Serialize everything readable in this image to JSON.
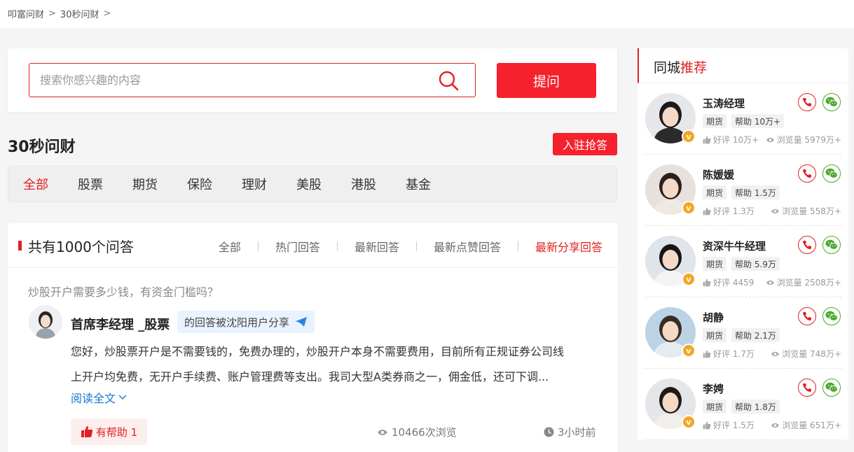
{
  "breadcrumb": [
    "叩富问财",
    "30秒问财"
  ],
  "breadcrumb_sep": ">",
  "search": {
    "placeholder": "搜索你感兴趣的内容",
    "button": "提问"
  },
  "section": {
    "title": "30秒问财",
    "join_button": "入驻抢答"
  },
  "categories": [
    "全部",
    "股票",
    "期货",
    "保险",
    "理财",
    "美股",
    "港股",
    "基金"
  ],
  "active_category": "全部",
  "qa": {
    "count_label": "共有1000个问答",
    "filters": [
      "全部",
      "热门回答",
      "最新回答",
      "最新点赞回答",
      "最新分享回答"
    ],
    "active_filter": "最新分享回答",
    "item": {
      "question": "炒股开户需要多少钱，有资金门槛吗？",
      "answerer": "首席李经理 _股票",
      "share_badge": "的回答被沈阳用户分享",
      "answer_line1": "您好，炒股票开户是不需要钱的，免费办理的，炒股开户本身不需要费用，目前所有正规证券公司线",
      "answer_line2": "上开户均免费，无开户手续费、账户管理费等支出。我司大型A类券商之一，佣金低，还可下调...",
      "read_more": "阅读全文",
      "helpful": "有帮助 1",
      "views": "10466次浏览",
      "time": "3小时前"
    }
  },
  "sidebar": {
    "title_plain": "同城",
    "title_red": "推荐",
    "experts": [
      {
        "name": "玉涛经理",
        "tag": "期货",
        "help": "帮助 10万+",
        "rating": "好评 10万+",
        "views": "浏览量 5979万+"
      },
      {
        "name": "陈媛媛",
        "tag": "期货",
        "help": "帮助 1.5万",
        "rating": "好评 1.3万",
        "views": "浏览量 558万+"
      },
      {
        "name": "资深牛牛经理",
        "tag": "期货",
        "help": "帮助 5.9万",
        "rating": "好评 4459",
        "views": "浏览量 2508万+"
      },
      {
        "name": "胡静",
        "tag": "期货",
        "help": "帮助 2.1万",
        "rating": "好评 1.7万",
        "views": "浏览量 748万+"
      },
      {
        "name": "李娉",
        "tag": "期货",
        "help": "帮助 1.8万",
        "rating": "好评 1.5万",
        "views": "浏览量 651万+"
      }
    ],
    "badge_letter": "v"
  },
  "colors": {
    "accent": "#f5222d",
    "link": "#1677d2",
    "wechat": "#4aa82c",
    "badge": "#f5a623"
  },
  "icons": [
    "search-icon",
    "paper-plane-icon",
    "chevron-down-icon",
    "thumbs-up-icon",
    "eye-icon",
    "clock-icon",
    "phone-icon",
    "wechat-icon"
  ]
}
